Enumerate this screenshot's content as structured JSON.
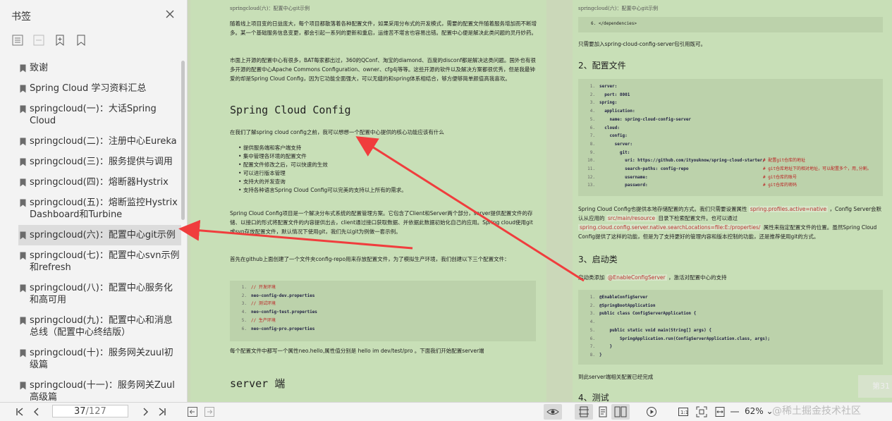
{
  "sidebar": {
    "title": "书签",
    "items": [
      {
        "label": "致谢"
      },
      {
        "label": "Spring Cloud 学习资料汇总"
      },
      {
        "label": "springcloud(一)：大话Spring Cloud"
      },
      {
        "label": "springcloud(二)：注册中心Eureka"
      },
      {
        "label": "springcloud(三)：服务提供与调用"
      },
      {
        "label": "springcloud(四)：熔断器Hystrix"
      },
      {
        "label": "springcloud(五)：熔断监控Hystrix Dashboard和Turbine"
      },
      {
        "label": "springcloud(六)：配置中心git示例"
      },
      {
        "label": "springcloud(七)：配置中心svn示例和refresh"
      },
      {
        "label": "springcloud(八)：配置中心服务化和高可用"
      },
      {
        "label": "springcloud(九)：配置中心和消息总线（配置中心终结版）"
      },
      {
        "label": "springcloud(十)：服务网关zuul初级篇"
      },
      {
        "label": "springcloud(十一)：服务网关Zuul高级篇"
      }
    ]
  },
  "left_page": {
    "header": "springcloud(六)：配置中心git示例",
    "p1": "随着线上项目变的日益庞大，每个项目都散落着各种配置文件，如果采用分布式的开发模式，需要的配置文件随着服务增加而不断增多。某一个基础服务信息变更，都会引起一系列的更新和重启，运维苦不堪言也容易出错。配置中心便是解决此类问题的灵丹妙药。",
    "p2": "市面上开源的配置中心有很多，BAT每家都出过，360的QConf、淘宝的diamond、百度的disconf都是解决这类问题。国外也有很多开源的配置中心Apache Commons Configuration、owner、cfg4j等等。这些开源的软件以及解决方案都很优秀，但是我最钟爱的却是Spring Cloud Config，因为它功能全面强大，可以无缝的和spring体系相结合，够方便够简单颜值高我喜欢。",
    "heading": "Spring Cloud Config",
    "p3": "在我们了解spring cloud config之前，我可以想想一个配置中心提供的核心功能应该有什么",
    "bullets": [
      "提供服务端和客户端支持",
      "集中管理各环境的配置文件",
      "配置文件修改之后，可以快速的生效",
      "可以进行版本管理",
      "支持大的并发查询",
      "支持各种语言Spring Cloud Config可以完美的支持以上所有的需求。"
    ],
    "p4": "Spring Cloud Config项目是一个解决分布式系统的配置管理方案。它包含了Client和Server两个部分，server提供配置文件的存储、以接口的形式将配置文件的内容提供出去，client通过接口获取数据、并依据此数据初始化自己的应用。Spring cloud使用git或svn存放配置文件，默认情况下使用git，我们先以git为例做一套示例。",
    "p5": "首先在github上面创建了一个文件夹config-repo用来存放配置文件，为了模拟生产环境，我们创建以下三个配置文件：",
    "code": [
      {
        "n": "1.",
        "t": "// 开发环境",
        "c": "cm"
      },
      {
        "n": "2.",
        "t": "neo-config-dev.properties",
        "c": "kw"
      },
      {
        "n": "3.",
        "t": "// 测试环境",
        "c": "cm"
      },
      {
        "n": "4.",
        "t": "neo-config-test.properties",
        "c": "kw"
      },
      {
        "n": "5.",
        "t": "// 生产环境",
        "c": "cm"
      },
      {
        "n": "6.",
        "t": "neo-config-pro.properties",
        "c": "kw"
      }
    ],
    "p6": "每个配置文件中都写一个属性neo.hello,属性值分别是 hello im dev/test/pro 。下面我们开始配置server端",
    "heading2": "server 端"
  },
  "right_page": {
    "header": "springcloud(六)：配置中心git示例",
    "top_code": "6.  </dependencies>",
    "p1": "只需要加入spring-cloud-config-server包引用既可。",
    "h_config": "2、配置文件",
    "yaml": [
      {
        "n": "1.",
        "t": "server:",
        "cm": ""
      },
      {
        "n": "2.",
        "t": "  port: 8001",
        "cm": ""
      },
      {
        "n": "3.",
        "t": "spring:",
        "cm": ""
      },
      {
        "n": "4.",
        "t": "  application:",
        "cm": ""
      },
      {
        "n": "5.",
        "t": "    name: spring-cloud-config-server",
        "cm": ""
      },
      {
        "n": "6.",
        "t": "  cloud:",
        "cm": ""
      },
      {
        "n": "7.",
        "t": "    config:",
        "cm": ""
      },
      {
        "n": "8.",
        "t": "      server:",
        "cm": ""
      },
      {
        "n": "9.",
        "t": "        git:",
        "cm": ""
      },
      {
        "n": "10.",
        "t": "          uri: https://github.com/ityouknow/spring-cloud-starter/",
        "cm": "# 配置git仓库的地址"
      },
      {
        "n": "11.",
        "t": "          search-paths: config-repo",
        "cm": "# git仓库地址下的相对地址，可以配置多个，用,分割。"
      },
      {
        "n": "12.",
        "t": "          username:",
        "cm": "# git仓库的账号"
      },
      {
        "n": "13.",
        "t": "          password:",
        "cm": "# git仓库的密码"
      }
    ],
    "p2a": "Spring Cloud Config也提供本地存储配置的方式。我们只需要设置属性",
    "p2code1": "spring.profiles.active=native",
    "p2b": "，Config Server会默认从应用的",
    "p2code2": "src/main/resource",
    "p2c": "目录下检索配置文件。也可以通过",
    "p2code3": "spring.cloud.config.server.native.searchLocations=file:E:/properties/",
    "p2d": "属性来指定配置文件的位置。虽然Spring Cloud Config提供了这样的功能，但是为了支持更好的管理内容和版本控制的功能，还是推荐使用git的方式。",
    "h_start": "3、启动类",
    "p3a": "启动类添加",
    "p3code": "@EnableConfigServer",
    "p3b": "，激活对配置中心的支持",
    "java": [
      {
        "n": "1.",
        "t": "@EnableConfigServer"
      },
      {
        "n": "2.",
        "t": "@SpringBootApplication"
      },
      {
        "n": "3.",
        "t": "public class ConfigServerApplication {"
      },
      {
        "n": "4.",
        "t": ""
      },
      {
        "n": "5.",
        "t": "    public static void main(String[] args) {"
      },
      {
        "n": "6.",
        "t": "        SpringApplication.run(ConfigServerApplication.class, args);"
      },
      {
        "n": "7.",
        "t": "    }"
      },
      {
        "n": "8.",
        "t": "}"
      }
    ],
    "p4": "到此server端相关配置已经完成",
    "h_test": "4、测试",
    "corner_text": "第31"
  },
  "toolbar": {
    "page_current": "37",
    "page_total": "/127",
    "zoom": "62%"
  },
  "watermark": "@稀土掘金技术社区"
}
